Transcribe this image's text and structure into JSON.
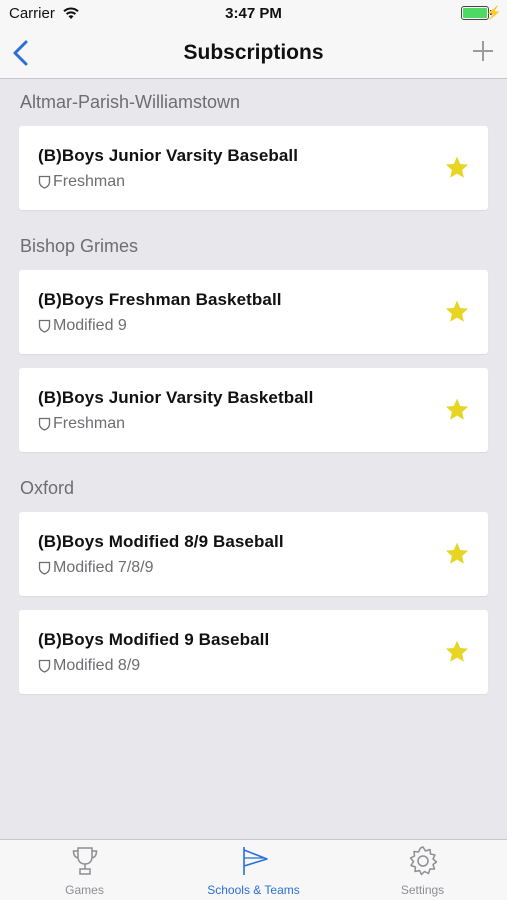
{
  "status_bar": {
    "carrier": "Carrier",
    "time": "3:47 PM",
    "battery_level": 1.0
  },
  "nav": {
    "title": "Subscriptions",
    "back_icon": "chevron-left-icon",
    "add_icon": "plus-icon"
  },
  "sections": [
    {
      "header": "Altmar-Parish-Williamstown",
      "items": [
        {
          "team": "(B)Boys Junior Varsity Baseball",
          "level": "Freshman"
        }
      ]
    },
    {
      "header": "Bishop Grimes",
      "items": [
        {
          "team": "(B)Boys Freshman Basketball",
          "level": "Modified 9"
        },
        {
          "team": "(B)Boys Junior Varsity Basketball",
          "level": "Freshman"
        }
      ]
    },
    {
      "header": "Oxford",
      "items": [
        {
          "team": "(B)Boys Modified 8/9 Baseball",
          "level": "Modified 7/8/9"
        },
        {
          "team": "(B)Boys Modified 9 Baseball",
          "level": "Modified 8/9"
        }
      ]
    }
  ],
  "tabs": [
    {
      "label": "Games",
      "icon": "trophy-icon",
      "active": false
    },
    {
      "label": "Schools & Teams",
      "icon": "flag-icon",
      "active": true
    },
    {
      "label": "Settings",
      "icon": "gear-icon",
      "active": false
    }
  ],
  "colors": {
    "accent": "#2a6fd8",
    "star": "#e8d423",
    "background": "#e7e7ec"
  }
}
